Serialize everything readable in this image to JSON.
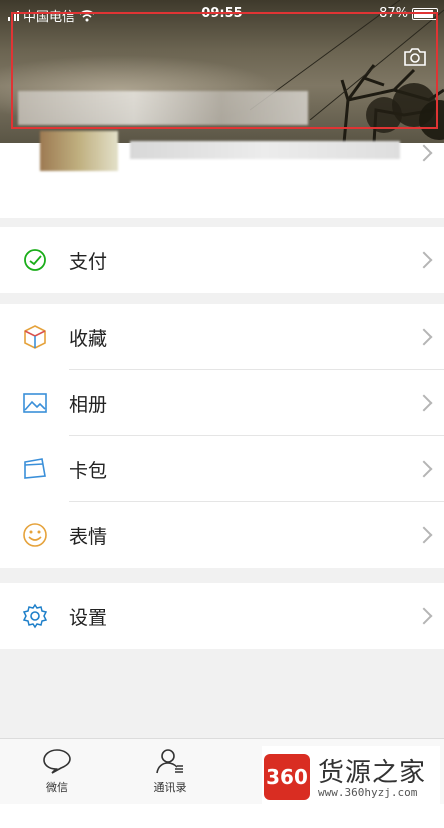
{
  "statusbar": {
    "carrier": "中国电信",
    "time": "09:55",
    "battery": "87%",
    "battery_fill": 0.87
  },
  "profile": {
    "name": "",
    "id": ""
  },
  "menu": {
    "pay": "支付",
    "favorites": "收藏",
    "album": "相册",
    "cards": "卡包",
    "stickers": "表情",
    "settings": "设置"
  },
  "tabbar": {
    "chats": "微信",
    "contacts": "通讯录"
  },
  "watermark": {
    "logo": "360",
    "title": "货源之家",
    "url": "www.360hyzj.com"
  },
  "colors": {
    "highlight_box": "#e03434",
    "pay_icon": "#1aad19",
    "settings_icon": "#1e7fc9"
  }
}
